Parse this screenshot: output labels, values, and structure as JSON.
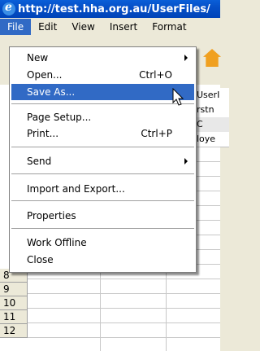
{
  "window": {
    "title": "http://test.hha.org.au/UserFiles/"
  },
  "menubar": [
    "File",
    "Edit",
    "View",
    "Insert",
    "Format"
  ],
  "file_menu": {
    "items": [
      {
        "label": "New",
        "shortcut": "",
        "submenu": true
      },
      {
        "label": "Open...",
        "shortcut": "Ctrl+O",
        "submenu": false
      },
      {
        "label": "Save As...",
        "shortcut": "",
        "submenu": false,
        "highlighted": true
      },
      {
        "label": "Page Setup...",
        "shortcut": "",
        "submenu": false
      },
      {
        "label": "Print...",
        "shortcut": "Ctrl+P",
        "submenu": false
      },
      {
        "label": "Send",
        "shortcut": "",
        "submenu": true
      },
      {
        "label": "Import and Export...",
        "shortcut": "",
        "submenu": false
      },
      {
        "label": "Properties",
        "shortcut": "",
        "submenu": false
      },
      {
        "label": "Work Offline",
        "shortcut": "",
        "submenu": false
      },
      {
        "label": "Close",
        "shortcut": "",
        "submenu": false
      }
    ]
  },
  "sheet": {
    "row_numbers": [
      "8",
      "9",
      "10",
      "11",
      "12"
    ],
    "peek_cells": [
      "UserI",
      "rstn",
      "C",
      "loye"
    ]
  },
  "colors": {
    "highlight": "#316ac5",
    "titlebar": "#0550c8",
    "menu_bg": "#ffffff"
  }
}
